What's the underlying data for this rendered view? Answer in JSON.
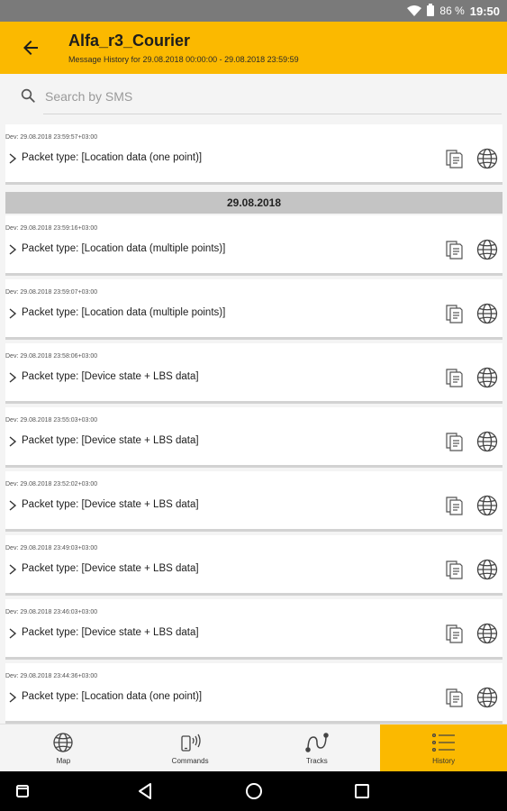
{
  "status_bar": {
    "battery": "86 %",
    "time": "19:50"
  },
  "header": {
    "title": "Alfa_r3_Courier",
    "subtitle": "Message History for 29.08.2018 00:00:00 - 29.08.2018 23:59:59"
  },
  "search": {
    "placeholder": "Search by SMS",
    "value": ""
  },
  "colors": {
    "accent": "#fbb900",
    "date_bar": "#c4c4c4"
  },
  "messages_top": [
    {
      "dev": "Dev: 29.08.2018 23:59:57+03:00",
      "packet": "Packet type: [Location data (one point)]"
    }
  ],
  "date_header": "29.08.2018",
  "messages": [
    {
      "dev": "Dev: 29.08.2018 23:59:16+03:00",
      "packet": "Packet type: [Location data (multiple points)]"
    },
    {
      "dev": "Dev: 29.08.2018 23:59:07+03:00",
      "packet": "Packet type: [Location data (multiple points)]"
    },
    {
      "dev": "Dev: 29.08.2018 23:58:06+03:00",
      "packet": "Packet type: [Device state + LBS data]"
    },
    {
      "dev": "Dev: 29.08.2018 23:55:03+03:00",
      "packet": "Packet type: [Device state + LBS data]"
    },
    {
      "dev": "Dev: 29.08.2018 23:52:02+03:00",
      "packet": "Packet type: [Device state + LBS data]"
    },
    {
      "dev": "Dev: 29.08.2018 23:49:03+03:00",
      "packet": "Packet type: [Device state + LBS data]"
    },
    {
      "dev": "Dev: 29.08.2018 23:46:03+03:00",
      "packet": "Packet type: [Device state + LBS data]"
    },
    {
      "dev": "Dev: 29.08.2018 23:44:36+03:00",
      "packet": "Packet type: [Location data (one point)]"
    }
  ],
  "bottom_nav": [
    {
      "label": "Map",
      "icon": "globe-icon",
      "active": false
    },
    {
      "label": "Commands",
      "icon": "phone-signal-icon",
      "active": false
    },
    {
      "label": "Tracks",
      "icon": "route-icon",
      "active": false
    },
    {
      "label": "History",
      "icon": "list-icon",
      "active": true
    }
  ]
}
